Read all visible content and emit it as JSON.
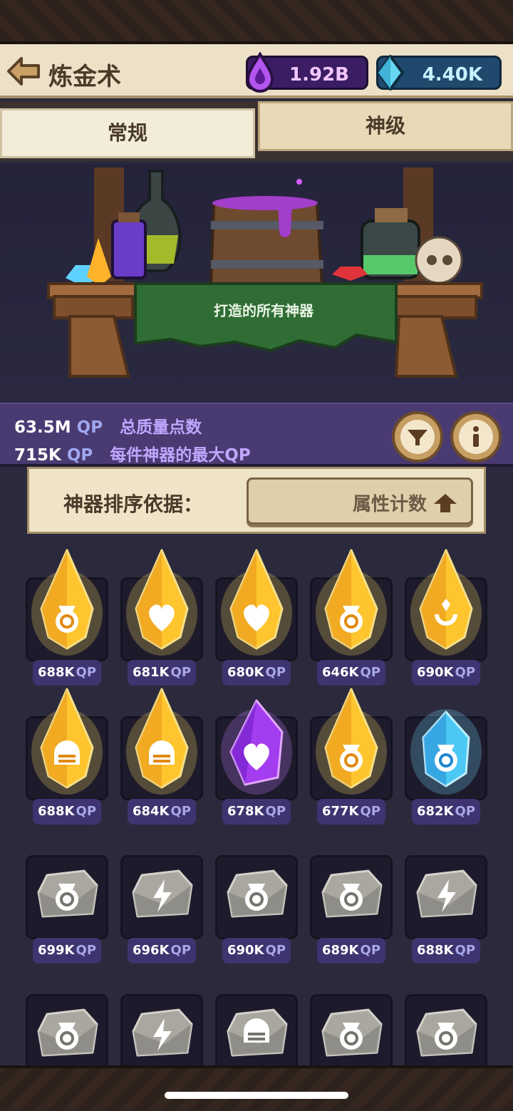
{
  "header": {
    "title": "炼金术",
    "purple_currency": "1.92B",
    "blue_currency": "4.40K"
  },
  "tabs": [
    {
      "label": "常规",
      "active": true
    },
    {
      "label": "神级",
      "active": false
    }
  ],
  "scene": {
    "label": "打造的所有神器"
  },
  "stats": {
    "total_value": "63.5M",
    "total_unit": "QP",
    "total_desc": "总质量点数",
    "max_value": "715K",
    "max_unit": "QP",
    "max_desc": "每件神器的最大QP"
  },
  "sort": {
    "label": "神器排序依据：",
    "value": "属性计数"
  },
  "items": [
    {
      "qp": "688K",
      "unit": "QP",
      "type": "gold",
      "icon": "bag-icon"
    },
    {
      "qp": "681K",
      "unit": "QP",
      "type": "gold",
      "icon": "heart-icon"
    },
    {
      "qp": "680K",
      "unit": "QP",
      "type": "gold",
      "icon": "heart-icon"
    },
    {
      "qp": "646K",
      "unit": "QP",
      "type": "gold",
      "icon": "bag-icon"
    },
    {
      "qp": "690K",
      "unit": "QP",
      "type": "gold",
      "icon": "flower-icon"
    },
    {
      "qp": "688K",
      "unit": "QP",
      "type": "gold",
      "icon": "helmet-icon"
    },
    {
      "qp": "684K",
      "unit": "QP",
      "type": "gold",
      "icon": "helmet-icon"
    },
    {
      "qp": "678K",
      "unit": "QP",
      "type": "purple",
      "icon": "heart-icon"
    },
    {
      "qp": "677K",
      "unit": "QP",
      "type": "gold",
      "icon": "bag-icon"
    },
    {
      "qp": "682K",
      "unit": "QP",
      "type": "blue",
      "icon": "bag-icon"
    },
    {
      "qp": "699K",
      "unit": "QP",
      "type": "stone",
      "icon": "bag-icon"
    },
    {
      "qp": "696K",
      "unit": "QP",
      "type": "stone",
      "icon": "lightning-icon"
    },
    {
      "qp": "690K",
      "unit": "QP",
      "type": "stone",
      "icon": "bag-icon"
    },
    {
      "qp": "689K",
      "unit": "QP",
      "type": "stone",
      "icon": "bag-icon"
    },
    {
      "qp": "688K",
      "unit": "QP",
      "type": "stone",
      "icon": "lightning-icon"
    },
    {
      "qp": "",
      "unit": "",
      "type": "stone",
      "icon": "bag-icon"
    },
    {
      "qp": "",
      "unit": "",
      "type": "stone",
      "icon": "lightning-icon"
    },
    {
      "qp": "",
      "unit": "",
      "type": "stone",
      "icon": "helmet-icon"
    },
    {
      "qp": "",
      "unit": "",
      "type": "stone",
      "icon": "bag-icon"
    },
    {
      "qp": "",
      "unit": "",
      "type": "stone",
      "icon": "bag-icon"
    }
  ]
}
